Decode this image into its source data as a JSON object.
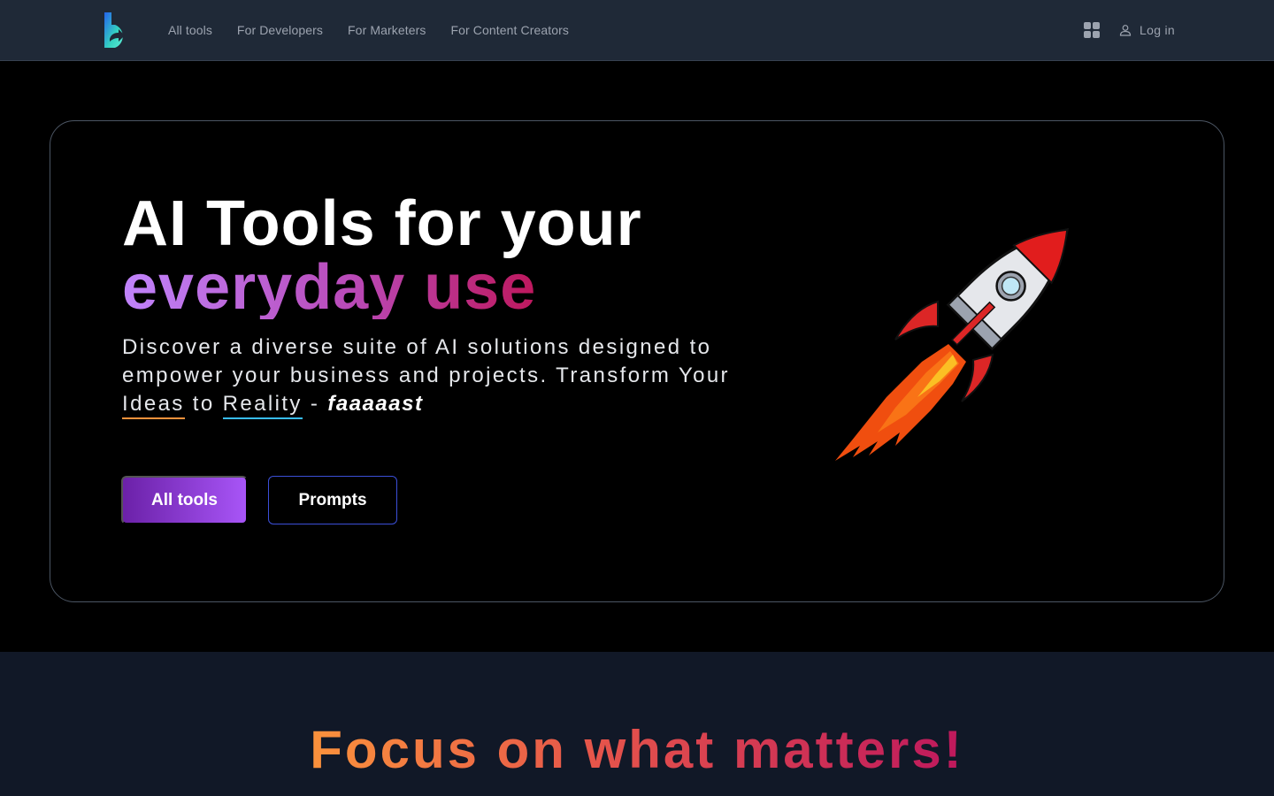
{
  "navbar": {
    "logo_alt": "b",
    "links": [
      {
        "label": "All tools"
      },
      {
        "label": "For Developers"
      },
      {
        "label": "For Marketers"
      },
      {
        "label": "For Content Creators"
      }
    ],
    "apps_icon": "grid-icon",
    "login_icon": "user-icon",
    "login_label": "Log in"
  },
  "hero": {
    "title_line1": "AI Tools for your",
    "title_line2": "everyday use",
    "subtitle_part1": "Discover a diverse suite of AI solutions designed to empower your business and projects. Transform Your ",
    "subtitle_ideas": "Ideas",
    "subtitle_to": " to ",
    "subtitle_reality": "Reality",
    "subtitle_dash": " - ",
    "subtitle_fast": "faaaaast",
    "primary_button": "All tools",
    "secondary_button": "Prompts",
    "illustration": "rocket-illustration"
  },
  "section2": {
    "title": "Focus on what matters!"
  },
  "colors": {
    "navbar_bg": "#1f2937",
    "hero_bg": "#000000",
    "section_bg": "#111827",
    "accent_purple": "#a855f7",
    "accent_pink": "#be185d",
    "accent_orange": "#fb923c",
    "accent_blue": "#38bdf8"
  }
}
